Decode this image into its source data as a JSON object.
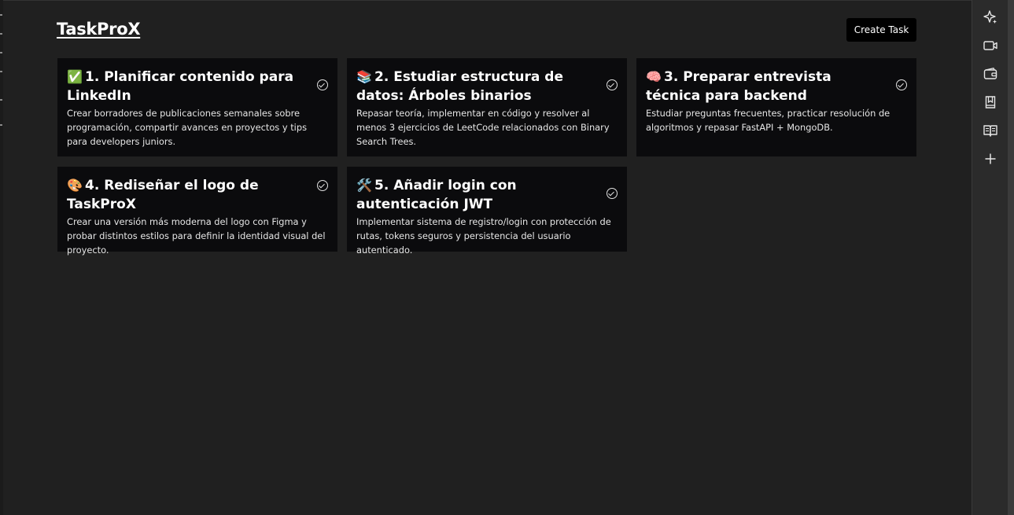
{
  "app": {
    "title": "TaskProX",
    "create_label": "Create Task"
  },
  "tasks": [
    {
      "emoji": "✅",
      "title": "1. Planificar contenido para LinkedIn",
      "description": "Crear borradores de publicaciones semanales sobre programación, compartir avances en proyectos y tips para developers juniors."
    },
    {
      "emoji": "📚",
      "title": "2. Estudiar estructura de datos: Árboles binarios",
      "description": "Repasar teoría, implementar en código y resolver al menos 3 ejercicios de LeetCode relacionados con Binary Search Trees."
    },
    {
      "emoji": "🧠",
      "title": "3. Preparar entrevista técnica para backend",
      "description": "Estudiar preguntas frecuentes, practicar resolución de algoritmos y repasar FastAPI + MongoDB."
    },
    {
      "emoji": "🎨",
      "title": "4. Rediseñar el logo de TaskProX",
      "description": "Crear una versión más moderna del logo con Figma y probar distintos estilos para definir la identidad visual del proyecto."
    },
    {
      "emoji": "🛠️",
      "title": "5. Añadir login con autenticación JWT",
      "description": "Implementar sistema de registro/login con protección de rutas, tokens seguros y persistencia del usuario autenticado."
    }
  ],
  "sidebar_icons": [
    "sparkle-icon",
    "video-icon",
    "wallet-icon",
    "bookmark-icon",
    "book-icon",
    "plus-icon"
  ],
  "colors": {
    "background": "#202020",
    "card": "#0b0b0d",
    "button": "#000000",
    "sidebar": "#2b2b2b"
  }
}
